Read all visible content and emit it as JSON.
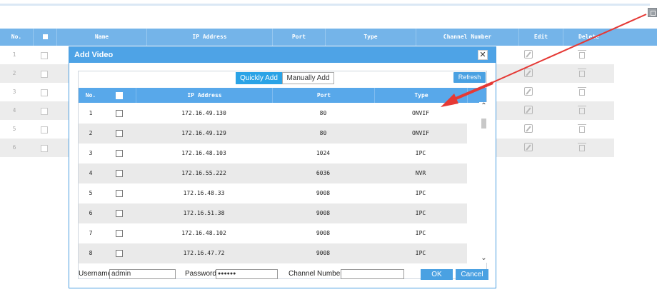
{
  "background_table": {
    "headers": [
      "No.",
      "",
      "Name",
      "IP Address",
      "Port",
      "Type",
      "Channel Number",
      "Edit",
      "Delete"
    ],
    "rows": [
      "1",
      "2",
      "3",
      "4",
      "5",
      "6"
    ]
  },
  "dialog": {
    "title": "Add Video",
    "close_glyph": "✕",
    "tabs": {
      "quick": "Quickly Add",
      "manual": "Manually Add"
    },
    "refresh_label": "Refresh",
    "table": {
      "headers": {
        "no": "No.",
        "ip": "IP Address",
        "port": "Port",
        "type": "Type"
      },
      "rows": [
        {
          "no": "1",
          "ip": "172.16.49.130",
          "port": "80",
          "type": "ONVIF"
        },
        {
          "no": "2",
          "ip": "172.16.49.129",
          "port": "80",
          "type": "ONVIF"
        },
        {
          "no": "3",
          "ip": "172.16.48.103",
          "port": "1024",
          "type": "IPC"
        },
        {
          "no": "4",
          "ip": "172.16.55.222",
          "port": "6036",
          "type": "NVR"
        },
        {
          "no": "5",
          "ip": "172.16.48.33",
          "port": "9008",
          "type": "IPC"
        },
        {
          "no": "6",
          "ip": "172.16.51.38",
          "port": "9008",
          "type": "IPC"
        },
        {
          "no": "7",
          "ip": "172.16.48.102",
          "port": "9008",
          "type": "IPC"
        },
        {
          "no": "8",
          "ip": "172.16.47.72",
          "port": "9008",
          "type": "IPC"
        }
      ]
    },
    "footer": {
      "username_label": "Username",
      "username_value": "admin",
      "password_label": "Password",
      "password_value": "●●●●●●",
      "channel_label": "Channel Number",
      "channel_value": "",
      "ok_label": "OK",
      "cancel_label": "Cancel"
    }
  },
  "colors": {
    "accent": "#4ea3e6",
    "tab_active": "#2aa3e6",
    "arrow": "#e53935"
  }
}
